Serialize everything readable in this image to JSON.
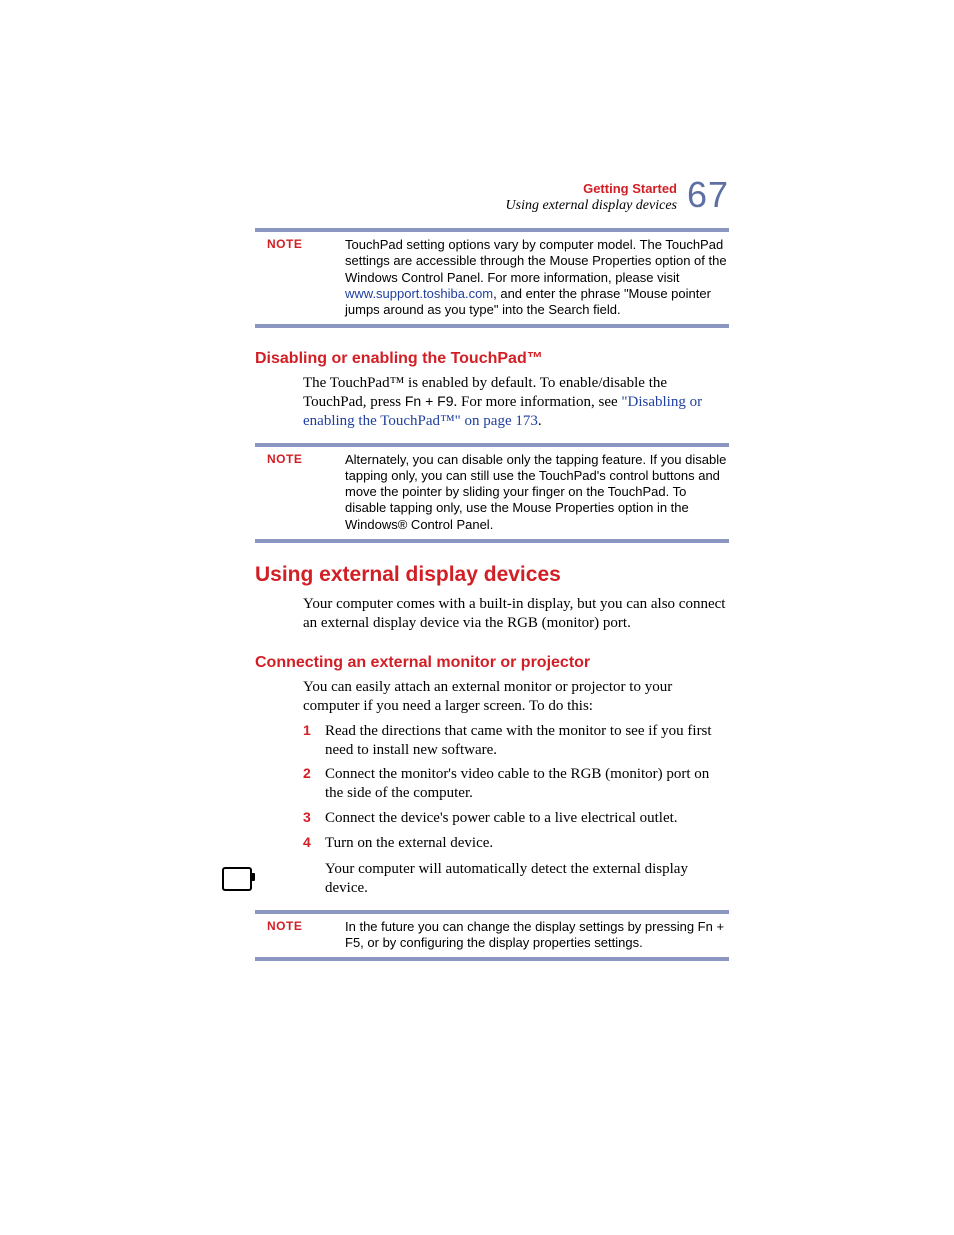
{
  "header": {
    "chapter": "Getting Started",
    "section": "Using external display devices",
    "page_number": "67"
  },
  "note1": {
    "label": "NOTE",
    "text_a": "TouchPad setting options vary by computer model. The TouchPad settings are accessible through the Mouse Properties option of the Windows Control Panel. For more information, please visit ",
    "url": "www.support.toshiba.com",
    "text_b": ", and enter the phrase \"Mouse pointer jumps around as you type\" into the Search field."
  },
  "section1": {
    "heading": "Disabling or enabling the TouchPad™",
    "para_a": "The TouchPad™ is enabled by default. To enable/disable the TouchPad, press ",
    "key_combo": "Fn + F9",
    "para_b": ". For more information, see ",
    "xref": "\"Disabling or enabling the TouchPad™\" on page 173",
    "para_c": "."
  },
  "note2": {
    "label": "NOTE",
    "text": "Alternately, you can disable only the tapping feature. If you disable tapping only, you can still use the TouchPad's control buttons and move the pointer by sliding your finger on the TouchPad. To disable tapping only, use the Mouse Properties option in the Windows® Control Panel."
  },
  "section2": {
    "heading": "Using external display devices",
    "para": "Your computer comes with a built-in display, but you can also connect an external display device via the RGB (monitor) port."
  },
  "section3": {
    "heading": "Connecting an external monitor or projector",
    "para": "You can easily attach an external monitor or projector to your computer if you need a larger screen. To do this:",
    "steps": [
      {
        "n": "1",
        "t": "Read the directions that came with the monitor to see if you first need to install new software."
      },
      {
        "n": "2",
        "t": "Connect the monitor's video cable to the RGB (monitor) port on the side of the computer."
      },
      {
        "n": "3",
        "t": "Connect the device's power cable to a live electrical outlet."
      },
      {
        "n": "4",
        "t": "Turn on the external device."
      }
    ],
    "followup": "Your computer will automatically detect the external display device."
  },
  "note3": {
    "label": "NOTE",
    "text_a": "In the future you can change the display settings by pressing ",
    "key_combo": "Fn + F5",
    "text_b": ", or by configuring the display properties settings."
  }
}
